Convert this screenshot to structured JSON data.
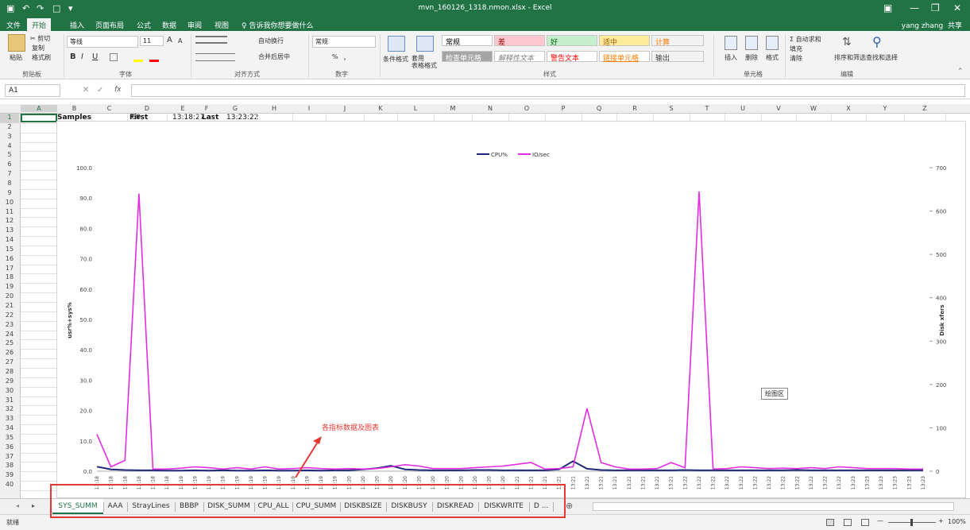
{
  "window": {
    "title": "mvn_160126_1318.nmon.xlsx - Excel",
    "user": "yang zhang",
    "share": "共享"
  },
  "ribbon_tabs": [
    "文件",
    "开始",
    "插入",
    "页面布局",
    "公式",
    "数据",
    "审阅",
    "视图",
    "♀ 告诉我你想要做什么"
  ],
  "ribbon": {
    "clipboard": {
      "paste": "粘贴",
      "cut": "✂ 剪切",
      "copy": "复制",
      "painter": "格式刷",
      "label": "剪贴板"
    },
    "font": {
      "name": "等线",
      "size": "11",
      "grow": "A",
      "shrink": "A",
      "bold": "B",
      "italic": "I",
      "underline": "U",
      "label": "字体"
    },
    "alignment": {
      "wrap": "自动换行",
      "merge": "合并后居中",
      "label": "对齐方式"
    },
    "number": {
      "format": "常规",
      "percent": "%",
      "comma": "，",
      "label": "数字"
    },
    "styles_cmds": {
      "conditional": "条件格式",
      "table": "套用\n表格格式"
    },
    "styles": [
      {
        "text": "常规",
        "bg": "#ffffff",
        "fg": "#000000"
      },
      {
        "text": "差",
        "bg": "#ffc7ce",
        "fg": "#9c0006"
      },
      {
        "text": "好",
        "bg": "#c6efce",
        "fg": "#006100"
      },
      {
        "text": "适中",
        "bg": "#ffeb9c",
        "fg": "#9c5700"
      },
      {
        "text": "计算",
        "bg": "#f2f2f2",
        "fg": "#fa7d00"
      },
      {
        "text": "检查单元格",
        "bg": "#a5a5a5",
        "fg": "#ffffff"
      },
      {
        "text": "解释性文本",
        "bg": "#ffffff",
        "fg": "#7f7f7f"
      },
      {
        "text": "警告文本",
        "bg": "#ffffff",
        "fg": "#ff0000"
      },
      {
        "text": "链接单元格",
        "bg": "#ffffff",
        "fg": "#fa7d00"
      },
      {
        "text": "输出",
        "bg": "#f2f2f2",
        "fg": "#3f3f3f"
      }
    ],
    "styles_label": "样式",
    "cells": {
      "insert": "插入",
      "delete": "删除",
      "format": "格式",
      "label": "单元格"
    },
    "editing": {
      "autosum": "Σ 自动求和",
      "fill": "填充",
      "clear": "清除",
      "sort": "排序和筛选",
      "find": "查找和选择",
      "label": "编辑"
    }
  },
  "formula_bar": {
    "name_box": "A1",
    "cancel": "✕",
    "enter": "✓",
    "fx": "fx",
    "value": ""
  },
  "columns": [
    "A",
    "B",
    "C",
    "D",
    "E",
    "F",
    "G",
    "H",
    "I",
    "J",
    "K",
    "L",
    "M",
    "N",
    "O",
    "P",
    "Q",
    "R",
    "S",
    "T",
    "U",
    "V",
    "W",
    "X",
    "Y",
    "Z"
  ],
  "row1": {
    "B": "Samples",
    "C": "60",
    "D": "First",
    "E": "13:18:27",
    "F": "Last",
    "G": "13:23:22"
  },
  "chart_data": {
    "type": "line",
    "series": [
      {
        "name": "CPU%",
        "color": "#1f2a7a",
        "axis": "left",
        "values": [
          1.5,
          0.6,
          0.4,
          0.3,
          0.3,
          0.2,
          0.2,
          0.3,
          0.2,
          0.3,
          0.2,
          0.2,
          0.3,
          0.2,
          0.2,
          0.3,
          0.2,
          0.3,
          0.3,
          0.6,
          1.0,
          1.8,
          0.6,
          0.4,
          0.3,
          0.3,
          0.3,
          0.4,
          0.4,
          0.3,
          0.3,
          0.3,
          0.3,
          0.6,
          3.3,
          0.8,
          0.4,
          0.3,
          0.3,
          0.3,
          0.3,
          0.3,
          0.4,
          0.3,
          0.3,
          0.3,
          0.3,
          0.3,
          0.3,
          0.3,
          0.4,
          0.3,
          0.3,
          0.3,
          0.3,
          0.3,
          0.3,
          0.3,
          0.3,
          0.3
        ]
      },
      {
        "name": "IO/sec",
        "color": "#e22de2",
        "axis": "right",
        "values": [
          85,
          10,
          25,
          640,
          5,
          5,
          7,
          10,
          8,
          5,
          8,
          5,
          10,
          5,
          6,
          8,
          6,
          5,
          6,
          5,
          6,
          10,
          15,
          12,
          6,
          6,
          6,
          8,
          10,
          12,
          16,
          20,
          5,
          6,
          10,
          145,
          20,
          10,
          5,
          5,
          6,
          20,
          8,
          645,
          5,
          6,
          10,
          8,
          6,
          7,
          6,
          8,
          6,
          10,
          8,
          6,
          6,
          6,
          5,
          5
        ]
      }
    ],
    "x_labels": [
      "13:18",
      "13:18",
      "13:18",
      "13:18",
      "13:18",
      "13:18",
      "13:19",
      "13:19",
      "13:19",
      "13:19",
      "13:19",
      "13:19",
      "13:19",
      "13:19",
      "13:19",
      "13:19",
      "13:19",
      "13:19",
      "13:20",
      "13:20",
      "13:20",
      "13:20",
      "13:20",
      "13:20",
      "13:20",
      "13:20",
      "13:20",
      "13:20",
      "13:20",
      "13:20",
      "13:21",
      "13:21",
      "13:21",
      "13:21",
      "13:21",
      "13:21",
      "13:21",
      "13:21",
      "13:21",
      "13:21",
      "13:21",
      "13:21",
      "13:22",
      "13:22",
      "13:22",
      "13:22",
      "13:22",
      "13:22",
      "13:22",
      "13:22",
      "13:22",
      "13:22",
      "13:22",
      "13:22",
      "13:23",
      "13:23",
      "13:23",
      "13:23",
      "13:23",
      "13:23"
    ],
    "y_left": {
      "label": "usr%+sys%",
      "ticks": [
        "0.0",
        "10.0",
        "20.0",
        "30.0",
        "40.0",
        "50.0",
        "60.0",
        "70.0",
        "80.0",
        "90.0",
        "100.0"
      ],
      "range": [
        0,
        100
      ]
    },
    "y_right": {
      "label": "Disk xfers",
      "ticks": [
        "0",
        "100",
        "200",
        "300",
        "400",
        "500",
        "600",
        "700"
      ],
      "range": [
        0,
        700
      ]
    },
    "legend": "top-center",
    "plot_area_tag": "绘图区",
    "annotation": "各指标数据及图表"
  },
  "sheet_tabs": [
    "SYS_SUMM",
    "AAA",
    "StrayLines",
    "BBBP",
    "DISK_SUMM",
    "CPU_ALL",
    "CPU_SUMM",
    "DISKBSIZE",
    "DISKBUSY",
    "DISKREAD",
    "DISKWRITE",
    "D ..."
  ],
  "active_sheet": "SYS_SUMM",
  "status": {
    "ready": "就绪",
    "zoom": "100%"
  }
}
